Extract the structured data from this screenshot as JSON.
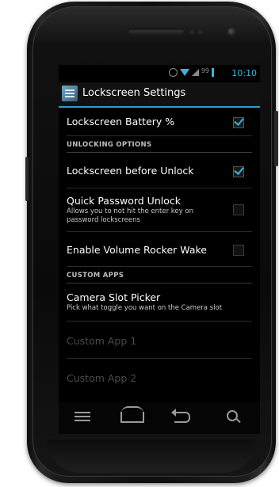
{
  "status_bar": {
    "battery_percent": "99",
    "time": "10:10"
  },
  "action_bar": {
    "title": "Lockscreen Settings",
    "app_icon": "settings-app-icon"
  },
  "preferences": {
    "battery": {
      "title": "Lockscreen Battery %",
      "checked": true
    },
    "unlocking_category": "UNLOCKING OPTIONS",
    "before_unlock": {
      "title": "Lockscreen before Unlock",
      "checked": true
    },
    "quick_password": {
      "title": "Quick Password Unlock",
      "summary": "Allows you to not hit the enter key on password lockscreens",
      "checked": false
    },
    "volume_rocker": {
      "title": "Enable Volume Rocker Wake",
      "checked": false
    },
    "custom_category": "CUSTOM APPS",
    "camera_slot": {
      "title": "Camera Slot Picker",
      "summary": "Pick what toggle you want on the Camera slot"
    },
    "custom_app_1": {
      "title": "Custom App 1",
      "enabled": false
    },
    "custom_app_2": {
      "title": "Custom App 2",
      "enabled": false
    }
  },
  "nav_bar": {
    "icons": [
      "menu-icon",
      "home-icon",
      "back-icon",
      "search-icon"
    ]
  },
  "colors": {
    "accent": "#33b5e5",
    "background": "#000000",
    "text": "#ffffff"
  }
}
